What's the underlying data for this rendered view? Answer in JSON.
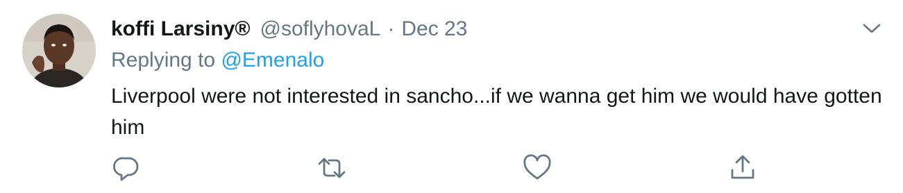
{
  "tweet": {
    "author": {
      "display_name": "koffi Larsiny®",
      "handle": "@soflyhovaL"
    },
    "separator": "·",
    "date": "Dec 23",
    "reply": {
      "prefix": "Replying to ",
      "mention": "@Emenalo"
    },
    "text": "Liverpool were not interested in sancho...if we wanna get him we would have gotten him"
  },
  "icons": {
    "caret": "chevron-down-icon",
    "reply": "reply-icon",
    "retweet": "retweet-icon",
    "like": "heart-icon",
    "share": "share-icon"
  },
  "colors": {
    "text_primary": "#14171a",
    "text_secondary": "#657786",
    "link": "#1da1f2",
    "background": "#ffffff"
  }
}
